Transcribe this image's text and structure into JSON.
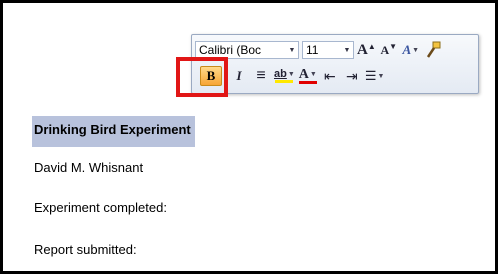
{
  "document": {
    "title": "Drinking Bird Experiment",
    "author": "David M. Whisnant",
    "line3": "Experiment completed:",
    "line4": "Report submitted:"
  },
  "mini_toolbar": {
    "font_name": "Calibri (Boc",
    "font_size": "11",
    "grow_font": "A",
    "shrink_font": "A",
    "styles": "A",
    "bold": "B",
    "italic": "I",
    "center": "≡",
    "highlight": "ab",
    "font_color": "A",
    "decrease_indent": "⇤",
    "increase_indent": "⇥",
    "bullets": "☰"
  },
  "colors": {
    "selection": "#b8c2dc",
    "callout": "#e11616",
    "highlight_bar": "#ffe800",
    "font_color_bar": "#e00000"
  }
}
